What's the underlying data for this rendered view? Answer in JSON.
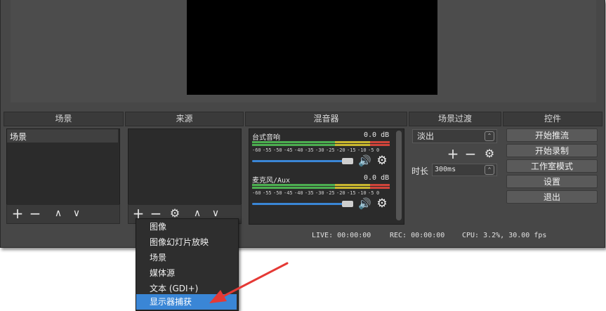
{
  "docks": {
    "scenes": {
      "title": "场景",
      "items": [
        "场景"
      ]
    },
    "sources": {
      "title": "来源"
    },
    "mixer": {
      "title": "混音器",
      "channels": [
        {
          "name": "台式音响",
          "db": "0.0 dB"
        },
        {
          "name": "麦克风/Aux",
          "db": "0.0 dB"
        }
      ],
      "tick_labels": [
        "-60",
        "-55",
        "-50",
        "-45",
        "-40",
        "-35",
        "-30",
        "-25",
        "-20",
        "-15",
        "-10",
        "-5",
        "0"
      ]
    },
    "transitions": {
      "title": "场景过渡",
      "selected": "淡出",
      "duration_label": "时长",
      "duration_value": "300ms"
    },
    "controls": {
      "title": "控件",
      "buttons": [
        "开始推流",
        "开始录制",
        "工作室模式",
        "设置",
        "退出"
      ]
    }
  },
  "toolbar_icons": {
    "add": "+",
    "remove": "−",
    "gear": "⚙",
    "up": "∧",
    "down": "∨"
  },
  "status_bar": {
    "live": "LIVE: 00:00:00",
    "rec": "REC: 00:00:00",
    "cpu": "CPU: 3.2%, 30.00 fps"
  },
  "context_menu": {
    "items": [
      "图像",
      "图像幻灯片放映",
      "场景",
      "媒体源",
      "文本 (GDI+)",
      "显示器捕获"
    ],
    "selected_index": 5
  },
  "colors": {
    "accent": "#3a86d6",
    "annotation": "#e53935",
    "meter_green": "#4caf50",
    "meter_yellow": "#c9b72f",
    "meter_red": "#d0443a"
  }
}
